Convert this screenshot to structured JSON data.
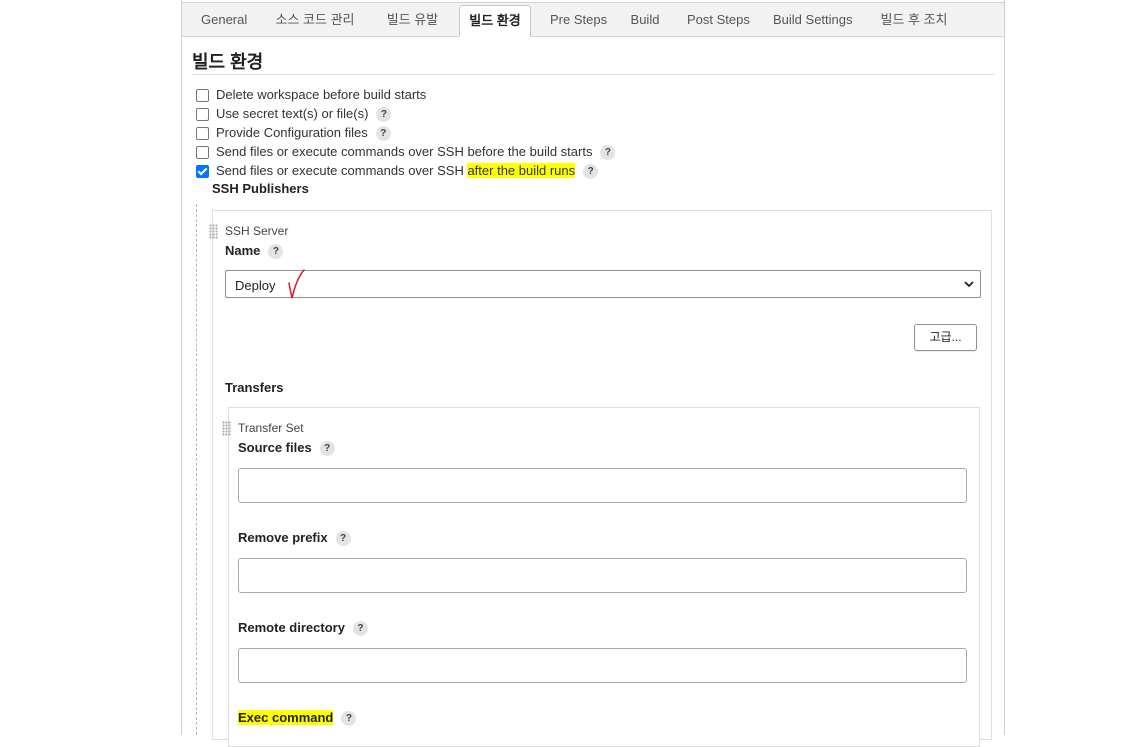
{
  "tabs": [
    "General",
    "소스 코드 관리",
    "빌드 유발",
    "빌드 환경",
    "Pre Steps",
    "Build",
    "Post Steps",
    "Build Settings",
    "빌드 후 조치"
  ],
  "active_tab": "빌드 환경",
  "section_title": "빌드 환경",
  "options": [
    {
      "label": "Delete workspace before build starts",
      "checked": false,
      "help": false
    },
    {
      "label": "Use secret text(s) or file(s)",
      "checked": false,
      "help": true
    },
    {
      "label": "Provide Configuration files",
      "checked": false,
      "help": true
    },
    {
      "label": "Send files or execute commands over SSH before the build starts",
      "checked": false,
      "help": true
    },
    {
      "label_prefix": "Send files or execute commands over SSH ",
      "label_highlight": "after the build runs",
      "checked": true,
      "help": true
    }
  ],
  "help_glyph": "?",
  "ssh_publishers": {
    "title": "SSH Publishers",
    "server": {
      "heading": "SSH Server",
      "name_label": "Name",
      "name_value": "Deploy",
      "advanced_button": "고급...",
      "transfers_label": "Transfers",
      "transfer_set": {
        "heading": "Transfer Set",
        "source_files_label": "Source files",
        "source_files_value": "",
        "remove_prefix_label": "Remove prefix",
        "remove_prefix_value": "",
        "remote_directory_label": "Remote directory",
        "remote_directory_value": "",
        "exec_command_label": "Exec command"
      }
    }
  },
  "colors": {
    "highlight": "#ffff00",
    "checkbox_checked": "#0075ff",
    "annotation_mark": "#e0202a"
  }
}
